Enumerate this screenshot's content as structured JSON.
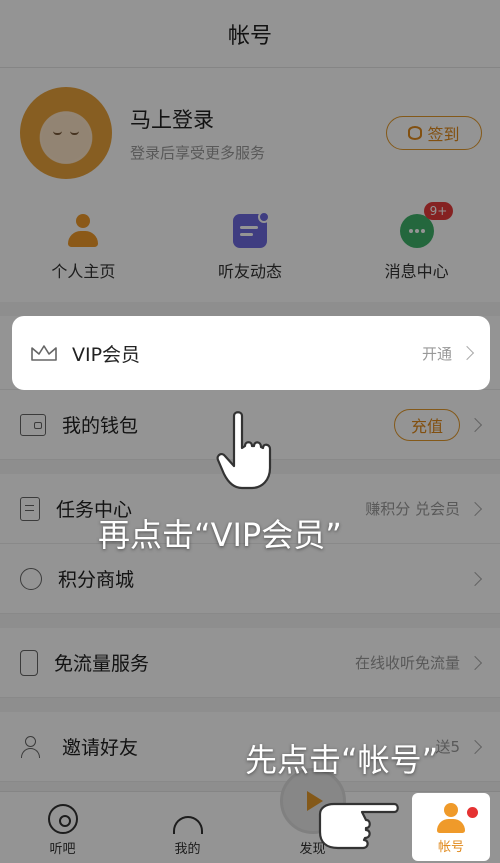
{
  "header": {
    "title": "帐号"
  },
  "profile": {
    "login_title": "马上登录",
    "login_subtitle": "登录后享受更多服务",
    "signin_label": "签到"
  },
  "quick_actions": [
    {
      "label": "个人主页",
      "icon": "person-icon"
    },
    {
      "label": "听友动态",
      "icon": "friend-feed-icon"
    },
    {
      "label": "消息中心",
      "icon": "message-icon",
      "badge": "9+"
    }
  ],
  "menu": {
    "vip": {
      "label": "VIP会员",
      "right": "开通"
    },
    "wallet": {
      "label": "我的钱包",
      "right": "充值"
    },
    "tasks": {
      "label": "任务中心",
      "right": "赚积分 兑会员"
    },
    "mall": {
      "label": "积分商城"
    },
    "traffic": {
      "label": "免流量服务",
      "right": "在线收听免流量"
    },
    "invite": {
      "label": "邀请好友",
      "right": "送5"
    }
  },
  "tabbar": {
    "tabs": [
      {
        "label": "听吧",
        "icon": "disc-icon"
      },
      {
        "label": "我的",
        "icon": "headphone-icon"
      },
      {
        "label": "发现",
        "icon": "play-icon"
      },
      {
        "label": "帐号",
        "icon": "account-icon"
      }
    ]
  },
  "captions": {
    "step1": "先点击“帐号”",
    "step2": "再点击“VIP会员”"
  },
  "colors": {
    "accent": "#e49a2c",
    "badge": "#e63b3b"
  }
}
